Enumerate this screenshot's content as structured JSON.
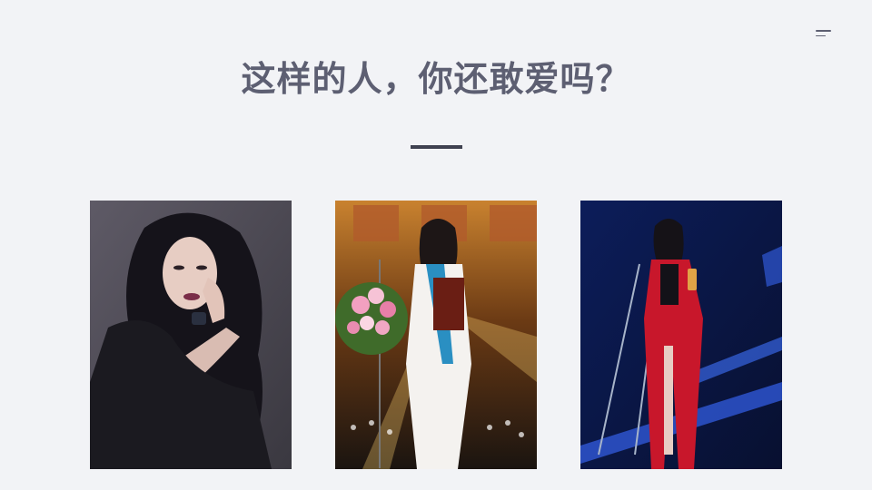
{
  "slide": {
    "title": "这样的人，你还敢爱吗？"
  },
  "icons": {
    "menu": "menu-icon"
  },
  "photos": [
    {
      "name": "portrait-black-outfit-photo"
    },
    {
      "name": "award-ceremony-white-suit-photo"
    },
    {
      "name": "stage-red-dress-photo"
    }
  ],
  "colors": {
    "background": "#f2f3f6",
    "title": "#5d5f72",
    "accent_bar": "#3f4150"
  }
}
